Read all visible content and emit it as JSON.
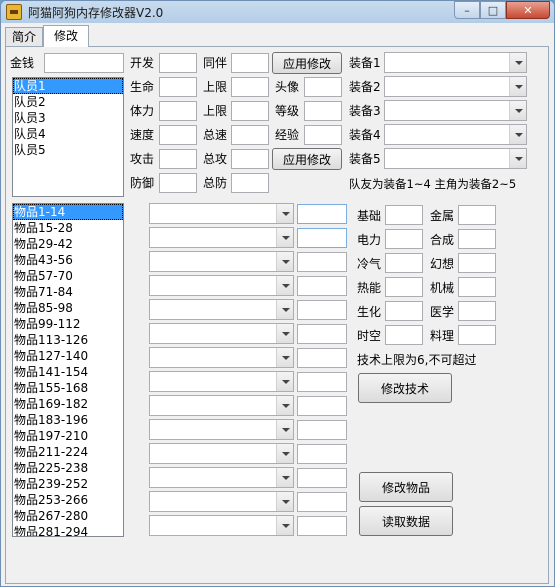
{
  "window": {
    "title": "阿猫阿狗内存修改器V2.0"
  },
  "tabs": [
    {
      "label": "简介"
    },
    {
      "label": "修改"
    }
  ],
  "money": {
    "label": "金钱",
    "value": ""
  },
  "members": [
    "队员1",
    "队员2",
    "队员3",
    "队员4",
    "队员5"
  ],
  "stats_col1": [
    "开发",
    "生命",
    "体力",
    "速度",
    "攻击",
    "防御"
  ],
  "stats_col2": [
    "同伴",
    "上限",
    "上限",
    "总速",
    "总攻",
    "总防"
  ],
  "stats_col3": [
    "头像",
    "等级",
    "经验"
  ],
  "buttons": {
    "apply1": "应用修改",
    "apply2": "应用修改",
    "modify_tech": "修改技术",
    "modify_items": "修改物品",
    "read_data": "读取数据"
  },
  "equips": [
    "装备1",
    "装备2",
    "装备3",
    "装备4",
    "装备5"
  ],
  "equip_note": "队友为装备1~4    主角为装备2~5",
  "items": [
    "物品1-14",
    "物品15-28",
    "物品29-42",
    "物品43-56",
    "物品57-70",
    "物品71-84",
    "物品85-98",
    "物品99-112",
    "物品113-126",
    "物品127-140",
    "物品141-154",
    "物品155-168",
    "物品169-182",
    "物品183-196",
    "物品197-210",
    "物品211-224",
    "物品225-238",
    "物品239-252",
    "物品253-266",
    "物品267-280",
    "物品281-294"
  ],
  "tech_left": [
    "基础",
    "电力",
    "冷气",
    "热能",
    "生化",
    "时空"
  ],
  "tech_right": [
    "金属",
    "合成",
    "幻想",
    "机械",
    "医学",
    "料理"
  ],
  "tech_note": "技术上限为6,不可超过",
  "colors": {
    "selection": "#3399ff",
    "panel": "#f0f0f0"
  }
}
